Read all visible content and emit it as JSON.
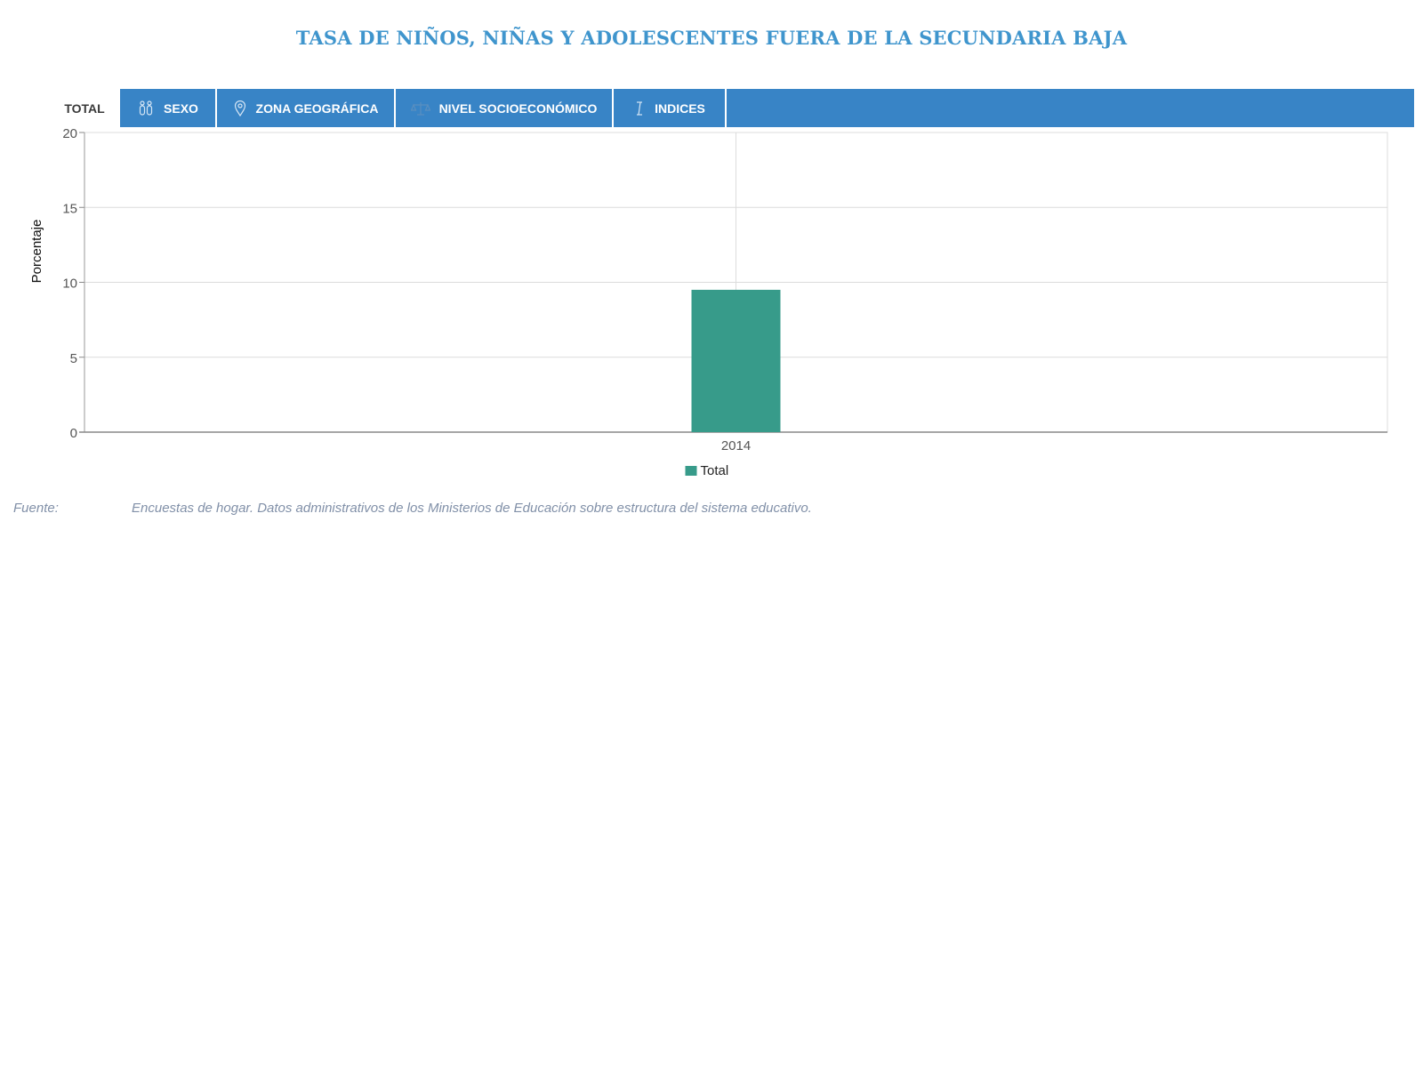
{
  "page": {
    "title": "TASA DE NIÑOS, NIÑAS Y ADOLESCENTES FUERA DE LA SECUNDARIA BAJA"
  },
  "tabs": [
    {
      "label": "TOTAL",
      "icon": "",
      "active": true
    },
    {
      "label": "SEXO",
      "icon": "gender-icon",
      "active": false
    },
    {
      "label": "ZONA GEOGRÁFICA",
      "icon": "map-pin-icon",
      "active": false
    },
    {
      "label": "NIVEL SOCIOECONÓMICO",
      "icon": "scale-icon",
      "active": false
    },
    {
      "label": "INDICES",
      "icon": "index-icon",
      "active": false
    }
  ],
  "colors": {
    "title": "#3f95cd",
    "tab_bar": "#3884c6",
    "bar_total": "#379b8a",
    "source_text": "#8190a8"
  },
  "chart_data": {
    "type": "bar",
    "categories": [
      "2014"
    ],
    "series": [
      {
        "name": "Total",
        "values": [
          9.5
        ],
        "color": "#379b8a"
      }
    ],
    "ylabel": "Porcentaje",
    "xlabel": "",
    "ylim": [
      0,
      20
    ],
    "yticks": [
      "0",
      "5",
      "10",
      "15",
      "20"
    ],
    "grid": true,
    "legend": "bottom-center"
  },
  "source": {
    "label": "Fuente:",
    "text": "Encuestas de hogar. Datos administrativos de los Ministerios de Educación sobre estructura del sistema educativo."
  }
}
